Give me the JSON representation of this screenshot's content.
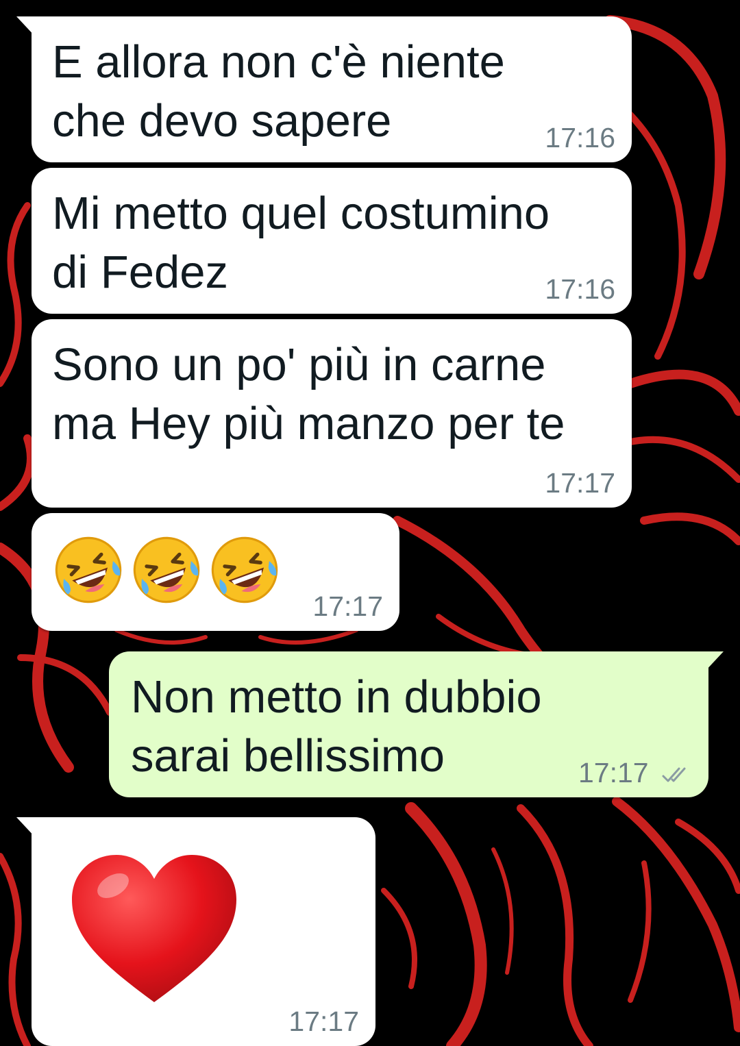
{
  "colors": {
    "incoming": "#ffffff",
    "outgoing": "#e2fec9",
    "wallpaper_bg": "#000000",
    "wallpaper_accent": "#c8201e"
  },
  "messages": [
    {
      "direction": "incoming",
      "lines": [
        "E allora non c'è niente",
        "che devo sapere"
      ],
      "time": "17:16"
    },
    {
      "direction": "incoming",
      "lines": [
        "Mi metto quel costumino",
        "di Fedez"
      ],
      "time": "17:16"
    },
    {
      "direction": "incoming",
      "lines": [
        "Sono un po' più in carne",
        "ma Hey più manzo per te"
      ],
      "time": "17:17"
    },
    {
      "direction": "incoming",
      "emoji": "rolling-on-floor-laughing",
      "emoji_count": 3,
      "time": "17:17"
    },
    {
      "direction": "outgoing",
      "lines": [
        "Non metto in dubbio",
        "sarai bellissimo"
      ],
      "time": "17:17",
      "status": "read"
    },
    {
      "direction": "incoming",
      "emoji": "red-heart",
      "time": "17:17"
    }
  ]
}
